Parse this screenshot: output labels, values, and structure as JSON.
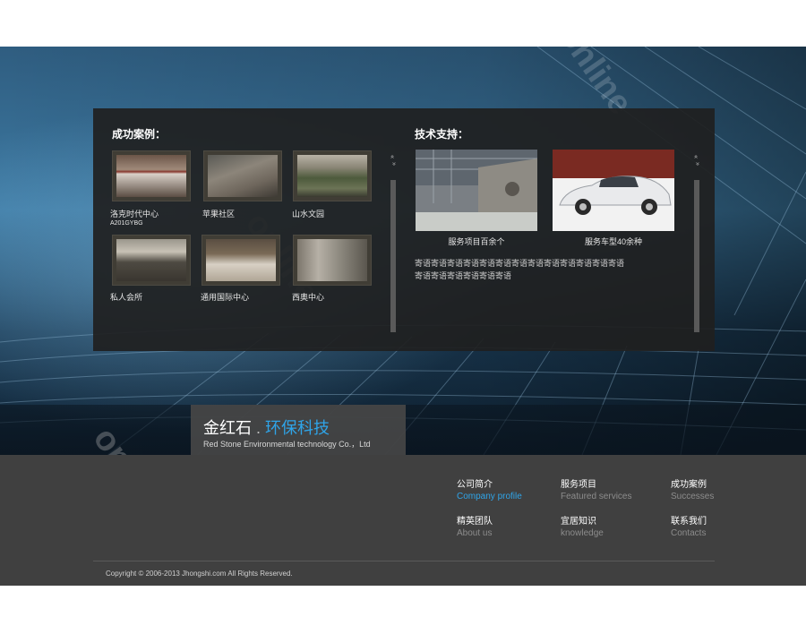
{
  "cases": {
    "title": "成功案例：",
    "items": [
      {
        "label": "洛克时代中心",
        "sub": "A201GYBG"
      },
      {
        "label": "苹果社区",
        "sub": ""
      },
      {
        "label": "山水文园",
        "sub": ""
      },
      {
        "label": "私人会所",
        "sub": ""
      },
      {
        "label": "通用国际中心",
        "sub": ""
      },
      {
        "label": "西奥中心",
        "sub": ""
      }
    ]
  },
  "tech": {
    "title": "技术支持：",
    "items": [
      {
        "caption": "服务项目百余个"
      },
      {
        "caption": "服务车型40余种"
      }
    ],
    "description": "寄语寄语寄语寄语寄语寄语寄语寄语寄语寄语寄语寄语寄语寄语寄语寄语寄语寄语寄语"
  },
  "scroll": {
    "up": "»",
    "down": "»"
  },
  "brand": {
    "name_cn": "金红石",
    "dot": ".",
    "accent_cn": "环保科技",
    "name_en": "Red Stone Environmental technology Co.，Ltd"
  },
  "footer": {
    "links": [
      {
        "cn": "公司简介",
        "en": "Company profile",
        "active": true
      },
      {
        "cn": "服务项目",
        "en": "Featured services",
        "active": false
      },
      {
        "cn": "成功案例",
        "en": "Successes",
        "active": false
      },
      {
        "cn": "精英团队",
        "en": "About us",
        "active": false
      },
      {
        "cn": "宜居知识",
        "en": "knowledge",
        "active": false
      },
      {
        "cn": "联系我们",
        "en": "Contacts",
        "active": false
      }
    ],
    "copyright": "Copyright © 2006-2013 Jhongshi.com All Rights Reserved."
  },
  "colors": {
    "accent": "#2fa4e8",
    "panel": "#202020",
    "footer": "#404040"
  },
  "watermark": "online"
}
